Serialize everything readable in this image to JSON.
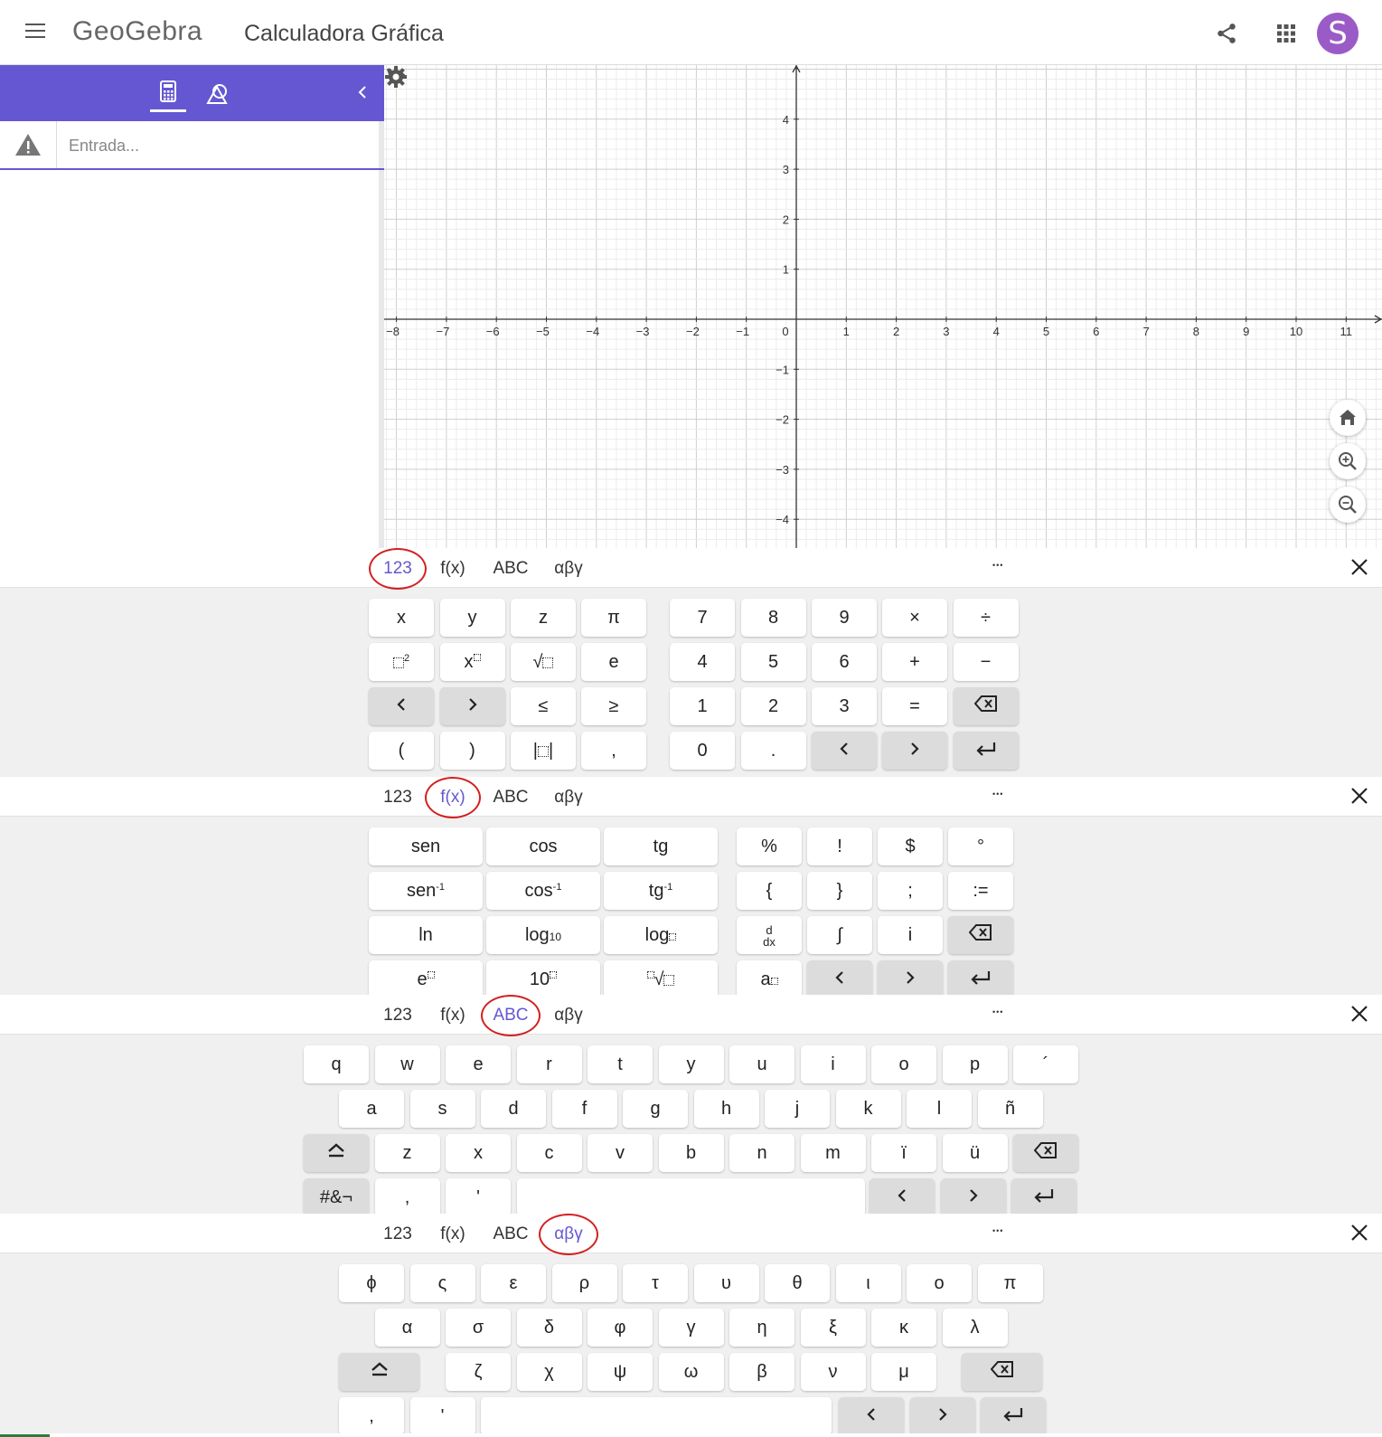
{
  "header": {
    "logo": "GeoGebra",
    "app_title": "Calculadora Gráfica",
    "avatar_letter": "S",
    "accent_color": "#6557d2"
  },
  "algebra": {
    "input_placeholder": "Entrada..."
  },
  "graph": {
    "x_ticks": [
      "−8",
      "−7",
      "−6",
      "−5",
      "−4",
      "−3",
      "−2",
      "−1",
      "0",
      "1",
      "2",
      "3",
      "4",
      "5",
      "6",
      "7",
      "8",
      "9",
      "10",
      "11"
    ],
    "y_ticks_pos": [
      "4",
      "3",
      "2",
      "1"
    ],
    "y_ticks_neg": [
      "−1",
      "−2",
      "−3",
      "−4"
    ],
    "x_range": [
      -8.3,
      11.4
    ],
    "y_range": [
      -4.4,
      5.1
    ],
    "grid": true
  },
  "keyboard_tabs": [
    "123",
    "f(x)",
    "ABC",
    "αβγ"
  ],
  "keyboards": [
    {
      "active_tab": 0,
      "rows": [
        [
          "x",
          "y",
          "z",
          "π",
          "7",
          "8",
          "9",
          "×",
          "÷"
        ],
        [
          "▢²",
          "x▢",
          "√▢",
          "e",
          "4",
          "5",
          "6",
          "+",
          "−"
        ],
        [
          "<",
          ">",
          "≤",
          "≥",
          "1",
          "2",
          "3",
          "=",
          "⌫"
        ],
        [
          "(",
          ")",
          "|▢|",
          ",",
          "0",
          ".",
          "<",
          ">",
          "↵"
        ]
      ]
    },
    {
      "active_tab": 1,
      "rows": [
        [
          "sen",
          "cos",
          "tg",
          "%",
          "!",
          "$",
          "°"
        ],
        [
          "sen⁻¹",
          "cos⁻¹",
          "tg⁻¹",
          "{",
          "}",
          ";",
          ":="
        ],
        [
          "ln",
          "log₁₀",
          "log▢",
          "d/dx",
          "∫",
          "i",
          "⌫"
        ],
        [
          "e▢",
          "10▢",
          "▢√▢",
          "a▢",
          "<",
          ">",
          "↵"
        ]
      ]
    },
    {
      "active_tab": 2,
      "rows": [
        [
          "q",
          "w",
          "e",
          "r",
          "t",
          "y",
          "u",
          "i",
          "o",
          "p",
          "´"
        ],
        [
          "a",
          "s",
          "d",
          "f",
          "g",
          "h",
          "j",
          "k",
          "l",
          "ñ"
        ],
        [
          "⇧",
          "z",
          "x",
          "c",
          "v",
          "b",
          "n",
          "m",
          "ï",
          "ü",
          "⌫"
        ],
        [
          "#&¬",
          ",",
          "'",
          "",
          "<",
          ">",
          "↵"
        ]
      ]
    },
    {
      "active_tab": 3,
      "rows": [
        [
          "ϕ",
          "ς",
          "ε",
          "ρ",
          "τ",
          "υ",
          "θ",
          "ι",
          "ο",
          "π"
        ],
        [
          "α",
          "σ",
          "δ",
          "φ",
          "γ",
          "η",
          "ξ",
          "κ",
          "λ"
        ],
        [
          "⇧",
          "ζ",
          "χ",
          "ψ",
          "ω",
          "β",
          "ν",
          "μ",
          "⌫"
        ],
        [
          ",",
          "'",
          "",
          "<",
          ">",
          "↵"
        ]
      ]
    }
  ]
}
